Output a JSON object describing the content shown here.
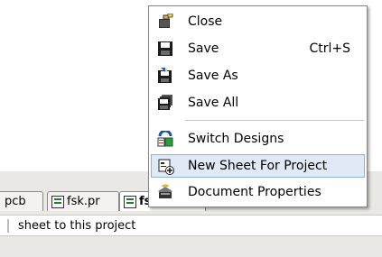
{
  "context_menu": {
    "items": [
      {
        "label": "Close",
        "shortcut": "",
        "icon": "close-file-icon"
      },
      {
        "label": "Save",
        "shortcut": "Ctrl+S",
        "icon": "floppy-disk-icon"
      },
      {
        "label": "Save As",
        "shortcut": "",
        "icon": "save-as-icon"
      },
      {
        "label": "Save All",
        "shortcut": "",
        "icon": "save-all-icon"
      },
      {
        "label": "Switch Designs",
        "shortcut": "",
        "icon": "switch-designs-icon"
      },
      {
        "label": "New Sheet For Project",
        "shortcut": "",
        "icon": "new-sheet-icon",
        "highlighted": true
      },
      {
        "label": "Document Properties",
        "shortcut": "",
        "icon": "document-properties-icon"
      }
    ]
  },
  "tabs": [
    {
      "label": "pcb"
    },
    {
      "label": "fsk.pr"
    },
    {
      "label": "fsk.sch"
    }
  ],
  "status_bar": {
    "text": "sheet to this project"
  },
  "colors": {
    "menu_highlight": "#dfeaf6",
    "menu_highlight_border": "#8bb3de",
    "app_background": "#e9e8e5"
  }
}
